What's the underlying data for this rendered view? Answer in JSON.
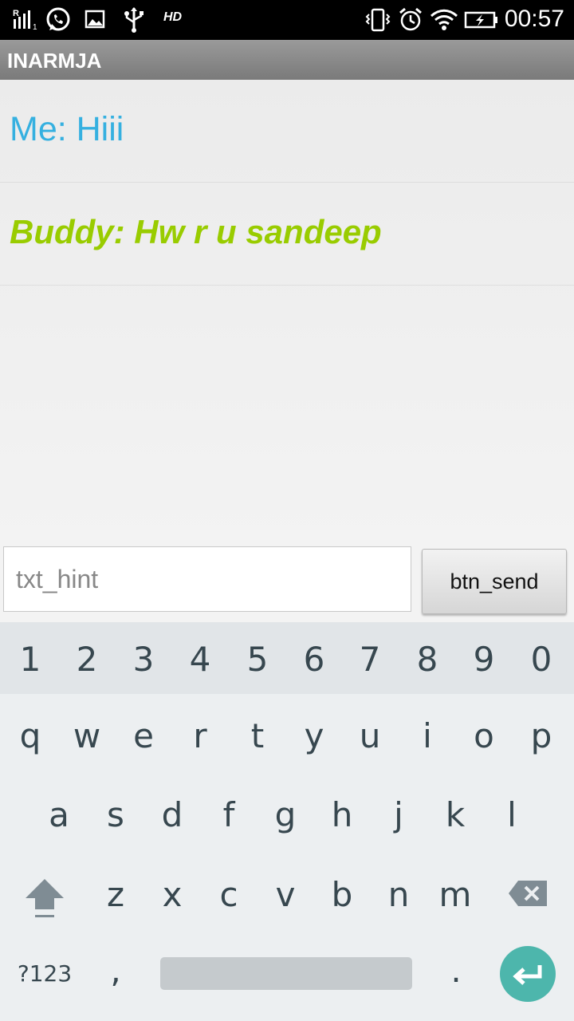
{
  "status_bar": {
    "hd_label": "HD",
    "time": "00:57",
    "icons": [
      "signal-icon",
      "whatsapp-icon",
      "image-icon",
      "usb-icon",
      "vibrate-icon",
      "alarm-icon",
      "wifi-icon",
      "battery-charging-icon"
    ]
  },
  "app": {
    "title": "INARMJA"
  },
  "messages": [
    {
      "text": "Me: Hiii",
      "color": "#35b0e0"
    },
    {
      "text": "Buddy: Hw r u sandeep",
      "color": "#99cc00"
    }
  ],
  "composer": {
    "placeholder": "txt_hint",
    "send_label": "btn_send"
  },
  "keyboard": {
    "numbers": [
      "1",
      "2",
      "3",
      "4",
      "5",
      "6",
      "7",
      "8",
      "9",
      "0"
    ],
    "row1": [
      "q",
      "w",
      "e",
      "r",
      "t",
      "y",
      "u",
      "i",
      "o",
      "p"
    ],
    "row2": [
      "a",
      "s",
      "d",
      "f",
      "g",
      "h",
      "j",
      "k",
      "l"
    ],
    "row3": [
      "z",
      "x",
      "c",
      "v",
      "b",
      "n",
      "m"
    ],
    "symbols_label": "?123",
    "comma": ",",
    "period": ".",
    "accent": "#4db6ac"
  }
}
